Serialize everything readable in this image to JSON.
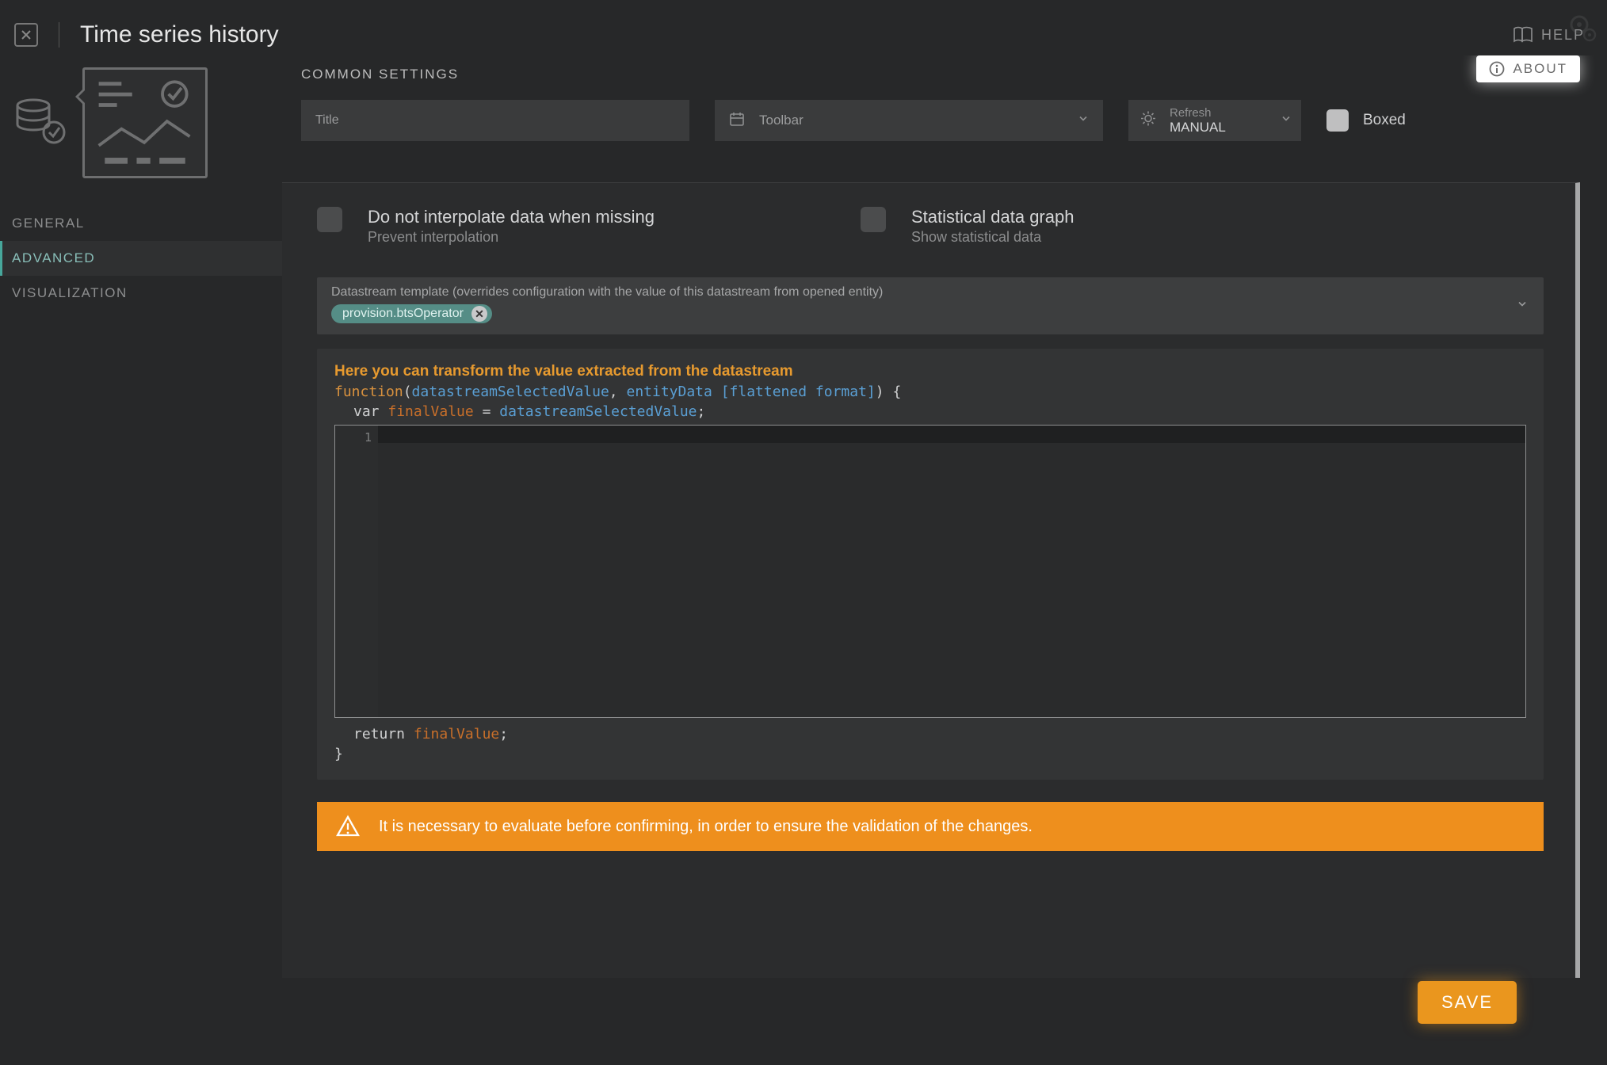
{
  "header": {
    "title": "Time series history",
    "help_label": "HELP"
  },
  "sidebar": {
    "tabs": [
      {
        "label": "GENERAL"
      },
      {
        "label": "ADVANCED"
      },
      {
        "label": "VISUALIZATION"
      }
    ]
  },
  "common": {
    "heading": "COMMON SETTINGS",
    "about_label": "ABOUT",
    "title_placeholder": "Title",
    "toolbar_label": "Toolbar",
    "refresh_label": "Refresh",
    "refresh_value": "MANUAL",
    "boxed_label": "Boxed"
  },
  "options": {
    "interpolate_title": "Do not interpolate data when missing",
    "interpolate_sub": "Prevent interpolation",
    "stat_title": "Statistical data graph",
    "stat_sub": "Show statistical data"
  },
  "template": {
    "desc": "Datastream template (overrides configuration with the value of this datastream from opened entity)",
    "chip": "provision.btsOperator"
  },
  "code": {
    "hint": "Here you can transform the value extracted from the datastream",
    "fn": "function",
    "arg1": "datastreamSelectedValue",
    "arg2": "entityData [flattened format]",
    "kw_var": "var",
    "final": "finalValue",
    "assign_rhs": "datastreamSelectedValue",
    "ret": "return",
    "line_num": "1"
  },
  "warning": "It is necessary to evaluate before confirming, in order to ensure the validation of the changes.",
  "save_label": "SAVE"
}
